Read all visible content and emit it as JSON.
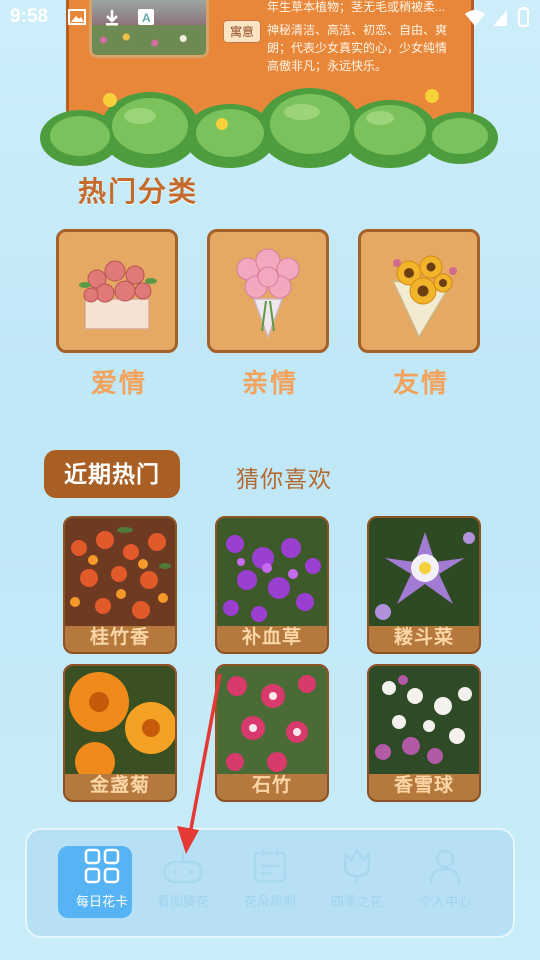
{
  "status_bar": {
    "time": "9:58"
  },
  "top_card": {
    "desc_line1": "年生草本植物；茎无毛或稍被柔...",
    "tag_label": "寓意",
    "meaning_text": "神秘清洁、高洁、初恋、自由、爽朗；代表少女真实的心，少女纯情高傲非凡；永远快乐。"
  },
  "hot_categories": {
    "title": "热门分类",
    "items": [
      {
        "label": "爱情"
      },
      {
        "label": "亲情"
      },
      {
        "label": "友情"
      }
    ]
  },
  "tabs": {
    "active": "近期热门",
    "inactive": "猜你喜欢"
  },
  "flowers": [
    {
      "name": "桂竹香"
    },
    {
      "name": "补血草"
    },
    {
      "name": "耧斗菜"
    },
    {
      "name": "金盏菊"
    },
    {
      "name": "石竹"
    },
    {
      "name": "香雪球"
    }
  ],
  "nav": {
    "items": [
      {
        "label": "每日花卡",
        "icon": "grid-icon"
      },
      {
        "label": "看图猜花",
        "icon": "game-icon"
      },
      {
        "label": "花朵周期",
        "icon": "calendar-icon"
      },
      {
        "label": "四季之花",
        "icon": "tulip-icon"
      },
      {
        "label": "个人中心",
        "icon": "person-icon"
      }
    ]
  },
  "colors": {
    "accent": "#a95e23",
    "nav_active": "#56b3f4",
    "annotation_arrow": "#e53935"
  }
}
